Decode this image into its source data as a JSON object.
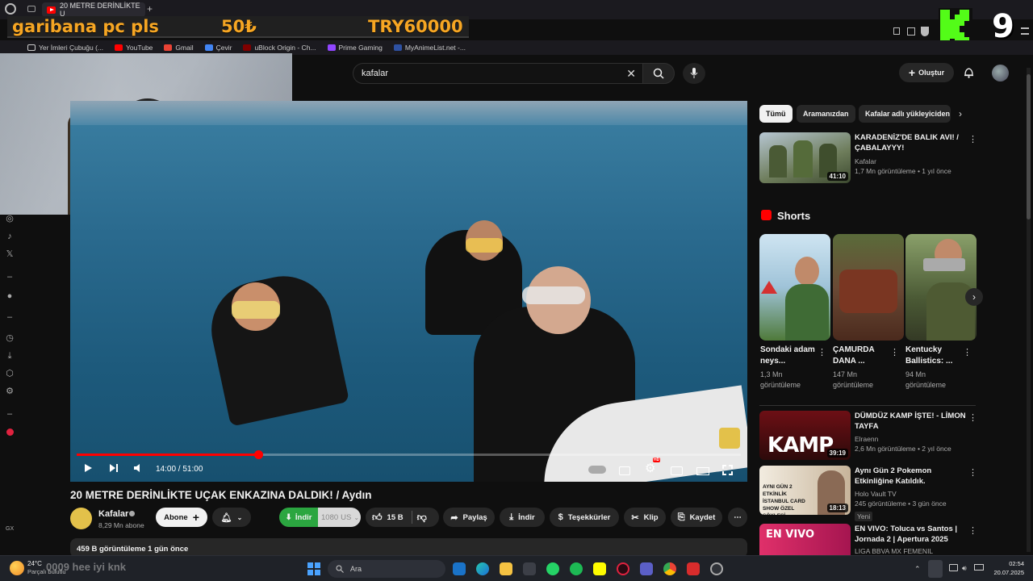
{
  "browser": {
    "tab_title": "20 METRE DERİNLİKTE U",
    "bookmarks": [
      "Yer İmleri Çubuğu (...",
      "YouTube",
      "Gmail",
      "Çevir",
      "uBlock Origin - Ch...",
      "Prime Gaming",
      "MyAnimeList.net -..."
    ]
  },
  "overlay": {
    "donation_message": "garibana pc pls",
    "donation_amount": "50₺",
    "donation_goal": "TRY60000",
    "kick_number": "9",
    "chat_ghost": "0009 hee iyi knk"
  },
  "header": {
    "search_value": "kafalar",
    "create_label": "Oluştur"
  },
  "player": {
    "time": "14:00 / 51:00",
    "progress_fraction": 0.2745,
    "settings_badge": "HD"
  },
  "video": {
    "title": "20 METRE DERİNLİKTE UÇAK ENKAZINA DALDIK! / Aydın",
    "channel": "Kafalar",
    "subscribers": "8,29 Mn abone",
    "subscribe_label": "Abone",
    "download_label": "İndir",
    "quality": "1080",
    "quality_currency": "US",
    "likes": "15 B",
    "share_label": "Paylaş",
    "download2_label": "İndir",
    "thanks_label": "Teşekkürler",
    "clip_label": "Klip",
    "save_label": "Kaydet",
    "desc_views": "459 B görüntüleme",
    "desc_date": "1 gün önce",
    "meta_line": "459 B görüntüleme  1 gün önce"
  },
  "sidebar_chips": [
    "Tümü",
    "Aramanızdan",
    "Kafalar adlı yükleyiciden"
  ],
  "related_top": {
    "title": "KARADENİZ'DE BALIK AVI! / ÇABALAYYY!",
    "channel": "Kafalar",
    "meta": "1,7 Mn görüntüleme • 1 yıl önce",
    "duration": "41:10"
  },
  "shorts_heading": "Shorts",
  "shorts": [
    {
      "title": "Sondaki adam neys...",
      "views": "1,3 Mn görüntüleme"
    },
    {
      "title": "ÇAMURDA DANA ...",
      "views": "147 Mn görüntüleme"
    },
    {
      "title": "Kentucky Ballistics: ...",
      "views": "94 Mn görüntüleme"
    }
  ],
  "related": [
    {
      "title": "DÜMDÜZ KAMP İŞTE!  - LİMON TAYFA",
      "channel": "Elraenn",
      "meta": "2,6 Mn görüntüleme • 2 yıl önce",
      "duration": "39:19",
      "thumb_text": "KAMP"
    },
    {
      "title": "Aynı Gün 2 Pokemon Etkinliğine Katıldık.",
      "channel": "Holo Vault TV",
      "meta": "245 görüntüleme • 3 gün önce",
      "badge": "Yeni",
      "duration": "18:13",
      "thumb_text": "AYNI GÜN 2 ETKİNLİK İSTANBUL CARD SHOW ÖZEL SÖYLEŞİ"
    },
    {
      "title": "EN VIVO: Toluca vs Santos | Jornada 2 | Apertura 2025",
      "channel": "LIGA BBVA MX FEMENIL",
      "thumb_text": "EN VIVO"
    }
  ],
  "taskbar": {
    "weather_temp": "24°C",
    "weather_desc": "Parçalı bulutlu",
    "search_placeholder": "Ara",
    "time": "02:54",
    "date": "20.07.2025"
  },
  "left_rail_label": "GX",
  "colors": {
    "accent": "#ff0000",
    "download_green": "#2ba640",
    "kick_green": "#53fc18",
    "donation_orange": "#f6a623"
  }
}
